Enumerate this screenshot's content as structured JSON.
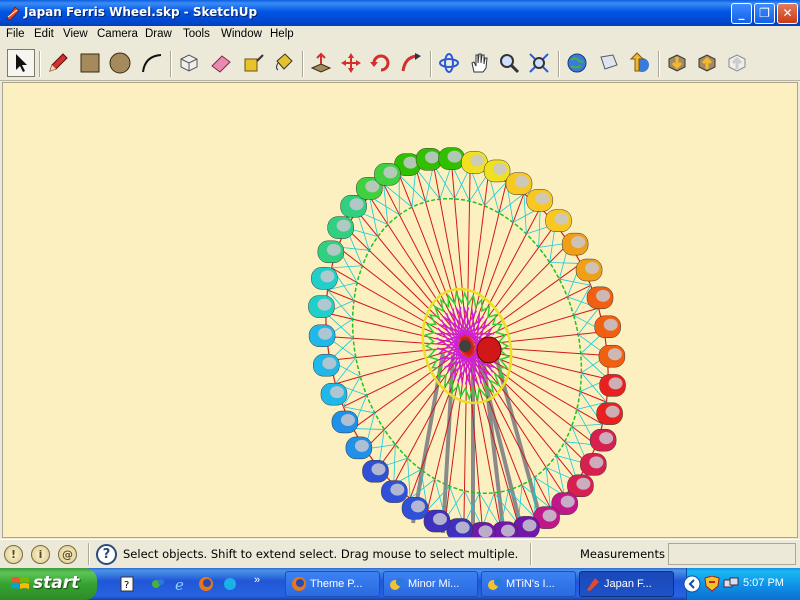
{
  "window": {
    "title": "Japan Ferris Wheel.skp - SketchUp",
    "minimize": "_",
    "maximize": "❐",
    "close": "✕"
  },
  "menu": [
    "File",
    "Edit",
    "View",
    "Camera",
    "Draw",
    "Tools",
    "Window",
    "Help"
  ],
  "toolbar": {
    "tools": [
      "select-tool",
      "pencil-tool",
      "rectangle-tool",
      "circle-tool",
      "arc-tool",
      "make-component-tool",
      "eraser-tool",
      "tape-measure-tool",
      "paint-bucket-tool",
      "push-pull-tool",
      "move-tool",
      "rotate-tool",
      "follow-me-tool",
      "orbit-tool",
      "pan-tool",
      "zoom-tool",
      "zoom-extents-tool",
      "get-models-tool",
      "share-model-tool",
      "upload-tool",
      "component-import-tool",
      "component-export-tool",
      "share-component-tool"
    ],
    "active": "select-tool"
  },
  "statusbar": {
    "text": "Select objects. Shift to extend select. Drag mouse to select multiple.",
    "measurements_label": "Measurements",
    "measurements_value": "",
    "help": "?"
  },
  "taskbar": {
    "start": "start",
    "quicklaunch_more": "»",
    "tasks": [
      {
        "label": "Theme P...",
        "icon": "firefox-icon"
      },
      {
        "label": "Minor Mi...",
        "icon": "messenger-icon"
      },
      {
        "label": "MTiN's I...",
        "icon": "messenger-icon"
      },
      {
        "label": "Japan F...",
        "icon": "sketchup-icon",
        "active": true
      }
    ],
    "clock": "5:07 PM"
  },
  "colors": {
    "viewport_bg": "#FCF0C0",
    "titlebar": "#0055E5",
    "taskbar": "#2157D7",
    "start": "#37A232"
  }
}
